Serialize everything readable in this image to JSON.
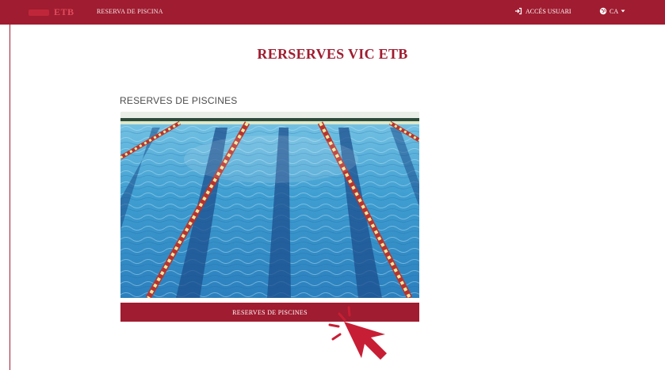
{
  "navbar": {
    "brand_text": "ETB",
    "title": "RESERVA DE PISCINA",
    "access_label": "ACCÉS USUARI",
    "lang_label": "CA",
    "bg_color": "#a01c30"
  },
  "main": {
    "title": "RERSERVES VIC ETB",
    "section_label": "RESERVES DE PISCINES",
    "button_label": "RESERVES DE PISCINES",
    "accent_color": "#a01c30"
  },
  "icons": {
    "access": "login-icon",
    "lang": "globe-icon",
    "lang_caret": "caret-down-icon",
    "pointer": "hand-pointer-icon"
  }
}
